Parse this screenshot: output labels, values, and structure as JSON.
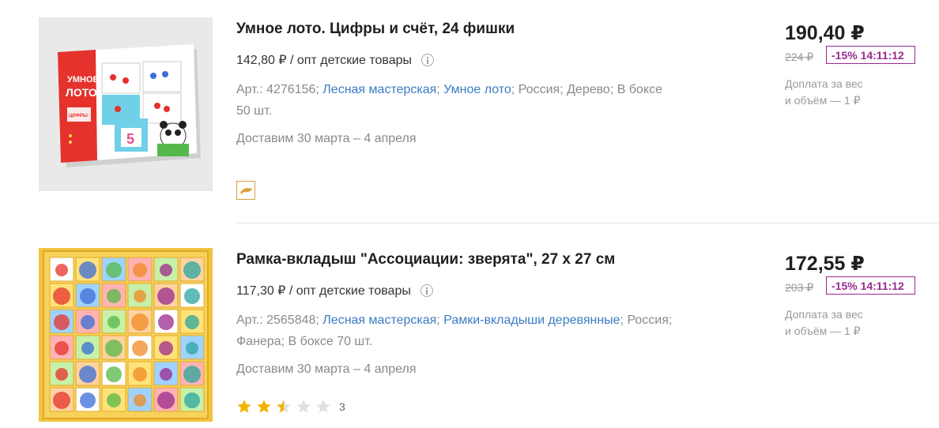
{
  "products": [
    {
      "image_alt": "Умное лото. Цифры и счёт",
      "title": "Умное лото. Цифры и счёт, 24 фишки",
      "opt_price": "142,80 ₽ / опт детские товары",
      "art_prefix": "Арт.: 4276156; ",
      "link_brand": "Лесная мастерская",
      "sep1": "; ",
      "link_category": "Умное лото",
      "attrs_rest": "; Россия; Дерево; В боксе 50 шт.",
      "delivery": "Доставим 30 марта – 4 апреля",
      "price": "190,40 ₽",
      "old_price": "224 ₽",
      "discount": "-15% 14:11:12",
      "surcharge_line1": "Доплата за вес",
      "surcharge_line2": "и объём — 1 ₽",
      "badge_icon": "dolphin-icon"
    },
    {
      "image_alt": "Рамка-вкладыш Ассоциации: зверята",
      "title": "Рамка-вкладыш \"Ассоциации: зверята\", 27 х 27 см",
      "opt_price": "117,30 ₽ / опт детские товары",
      "art_prefix": "Арт.: 2565848; ",
      "link_brand": "Лесная мастерская",
      "sep1": "; ",
      "link_category": "Рамки-вкладыши деревянные",
      "attrs_rest": "; Россия; Фанера; В боксе 70 шт.",
      "delivery": "Доставим 30 марта – 4 апреля",
      "price": "172,55 ₽",
      "old_price": "203 ₽",
      "discount": "-15% 14:11:12",
      "surcharge_line1": "Доплата за вес",
      "surcharge_line2": "и объём — 1 ₽",
      "rating": 2.5,
      "rating_max": 5,
      "reviews_count": "3"
    }
  ],
  "colors": {
    "link": "#3b7cc4",
    "discount": "#9a2a8e",
    "star_filled": "#f5b200",
    "star_empty": "#e0e0e0"
  }
}
